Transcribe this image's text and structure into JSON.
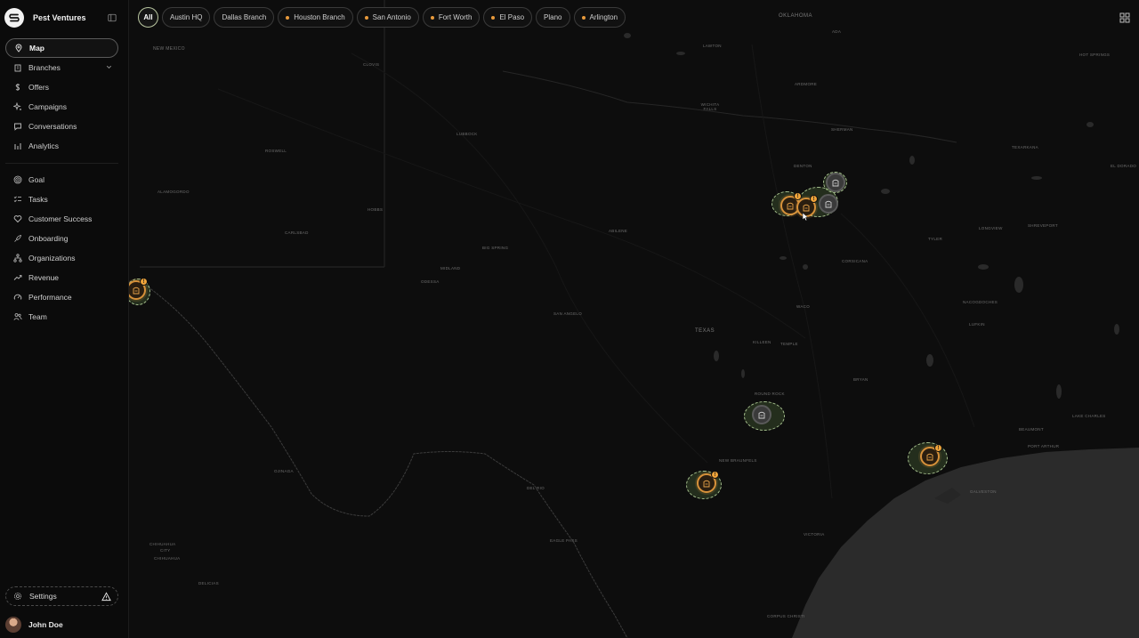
{
  "app": {
    "brand_name": "Pest Ventures"
  },
  "sidebar": {
    "primary": [
      {
        "label": "Map",
        "icon": "map-pin-icon",
        "active": true
      },
      {
        "label": "Branches",
        "icon": "building-icon",
        "has_chevron": true
      },
      {
        "label": "Offers",
        "icon": "dollar-icon"
      },
      {
        "label": "Campaigns",
        "icon": "sparkle-icon"
      },
      {
        "label": "Conversations",
        "icon": "chat-icon"
      },
      {
        "label": "Analytics",
        "icon": "bar-chart-icon"
      }
    ],
    "secondary": [
      {
        "label": "Goal",
        "icon": "target-icon"
      },
      {
        "label": "Tasks",
        "icon": "list-check-icon"
      },
      {
        "label": "Customer Success",
        "icon": "heart-hand-icon"
      },
      {
        "label": "Onboarding",
        "icon": "rocket-icon"
      },
      {
        "label": "Organizations",
        "icon": "org-tree-icon"
      },
      {
        "label": "Revenue",
        "icon": "trend-up-icon"
      },
      {
        "label": "Performance",
        "icon": "gauge-icon"
      },
      {
        "label": "Team",
        "icon": "users-icon"
      }
    ],
    "settings_label": "Settings",
    "user_name": "John Doe"
  },
  "filters": {
    "all_label": "All",
    "chips": [
      {
        "label": "Austin HQ",
        "dot": false
      },
      {
        "label": "Dallas Branch",
        "dot": false
      },
      {
        "label": "Houston Branch",
        "dot": true
      },
      {
        "label": "San Antonio",
        "dot": true
      },
      {
        "label": "Fort Worth",
        "dot": true
      },
      {
        "label": "El Paso",
        "dot": true
      },
      {
        "label": "Plano",
        "dot": false
      },
      {
        "label": "Arlington",
        "dot": true
      }
    ]
  },
  "map_labels": {
    "oklahoma": "OKLAHOMA",
    "new_mexico": "NEW MEXICO",
    "texas": "TEXAS",
    "lawton": "LAWTON",
    "clovis": "CLOVIS",
    "lubbock": "LUBBOCK",
    "roswell": "ROSWELL",
    "alamogordo": "ALAMOGORDO",
    "hobbs": "HOBBS",
    "carlsbad": "CARLSBAD",
    "midland": "MIDLAND",
    "odessa": "ODESSA",
    "big_spring": "BIG SPRING",
    "abilene": "ABILENE",
    "san_angelo": "SAN ANGELO",
    "wichita_falls": "WICHITA FALLS",
    "ardmore": "ARDMORE",
    "sherman": "SHERMAN",
    "denton": "DENTON",
    "texarkana": "TEXARKANA",
    "el_dorado": "EL DORADO",
    "hot_springs": "HOT SPRINGS",
    "tyler": "TYLER",
    "longview": "LONGVIEW",
    "shreveport": "SHREVEPORT",
    "corsicana": "CORSICANA",
    "waco": "WACO",
    "killeen": "KILLEEN",
    "temple": "TEMPLE",
    "bryan": "BRYAN",
    "nacogdoches": "NACOGDOCHES",
    "lufkin": "LUFKIN",
    "round_rock": "ROUND ROCK",
    "new_braunfels": "NEW BRAUNFELS",
    "beaumont": "BEAUMONT",
    "port_arthur": "PORT ARTHUR",
    "lake_charles": "LAKE CHARLES",
    "galveston": "GALVESTON",
    "victoria": "VICTORIA",
    "del_rio": "DEL RIO",
    "eagle_pass": "EAGLE PASS",
    "odessa2": "OJINAGA",
    "chihuahua": "CHIHUAHUA",
    "city": "CITY",
    "chihuahua2": "CHIHUAHUA",
    "delicias": "DELICIAS",
    "corpus": "CORPUS CHRISTI",
    "ada": "ADA"
  },
  "markers": {
    "badge_text": "!"
  }
}
